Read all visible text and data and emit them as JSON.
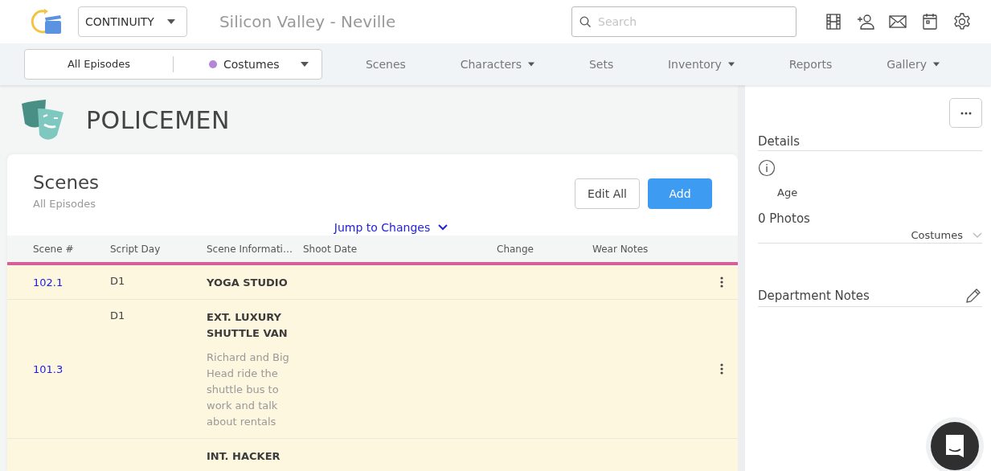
{
  "header": {
    "module": "CONTINUITY",
    "project_title": "Silicon Valley - Neville",
    "search": {
      "placeholder": "Search"
    }
  },
  "nav": {
    "episode_filter": "All Episodes",
    "department": {
      "label": "Costumes",
      "color": "#b386d8"
    },
    "items": [
      {
        "label": "Scenes",
        "dropdown": false
      },
      {
        "label": "Characters",
        "dropdown": true
      },
      {
        "label": "Sets",
        "dropdown": false
      },
      {
        "label": "Inventory",
        "dropdown": true
      },
      {
        "label": "Reports",
        "dropdown": false
      },
      {
        "label": "Gallery",
        "dropdown": true
      }
    ]
  },
  "character": {
    "name": "POLICEMEN"
  },
  "scenes_card": {
    "title": "Scenes",
    "subtitle": "All Episodes",
    "buttons": [
      {
        "label": "Edit All",
        "kind": "secondary"
      },
      {
        "label": "Add",
        "kind": "primary"
      }
    ],
    "jump_link": "Jump to Changes",
    "columns": [
      "Scene #",
      "Script Day",
      "Scene Informati…",
      "Shoot Date",
      "Change",
      "Wear Notes"
    ],
    "rows": [
      {
        "scene": "102.1",
        "script_day": "D1",
        "heading": "YOGA STUDIO"
      },
      {
        "scene": "101.3",
        "script_day": "D1",
        "heading": "EXT. LUXURY SHUTTLE VAN",
        "description": "Richard and Big Head ride the shuttle bus to work and talk about rentals"
      },
      {
        "heading": "INT. HACKER"
      }
    ]
  },
  "details": {
    "title": "Details",
    "fields": [
      "Age"
    ],
    "photos_title": "0 Photos",
    "photos_filter": "Costumes",
    "notes_title": "Department Notes"
  }
}
